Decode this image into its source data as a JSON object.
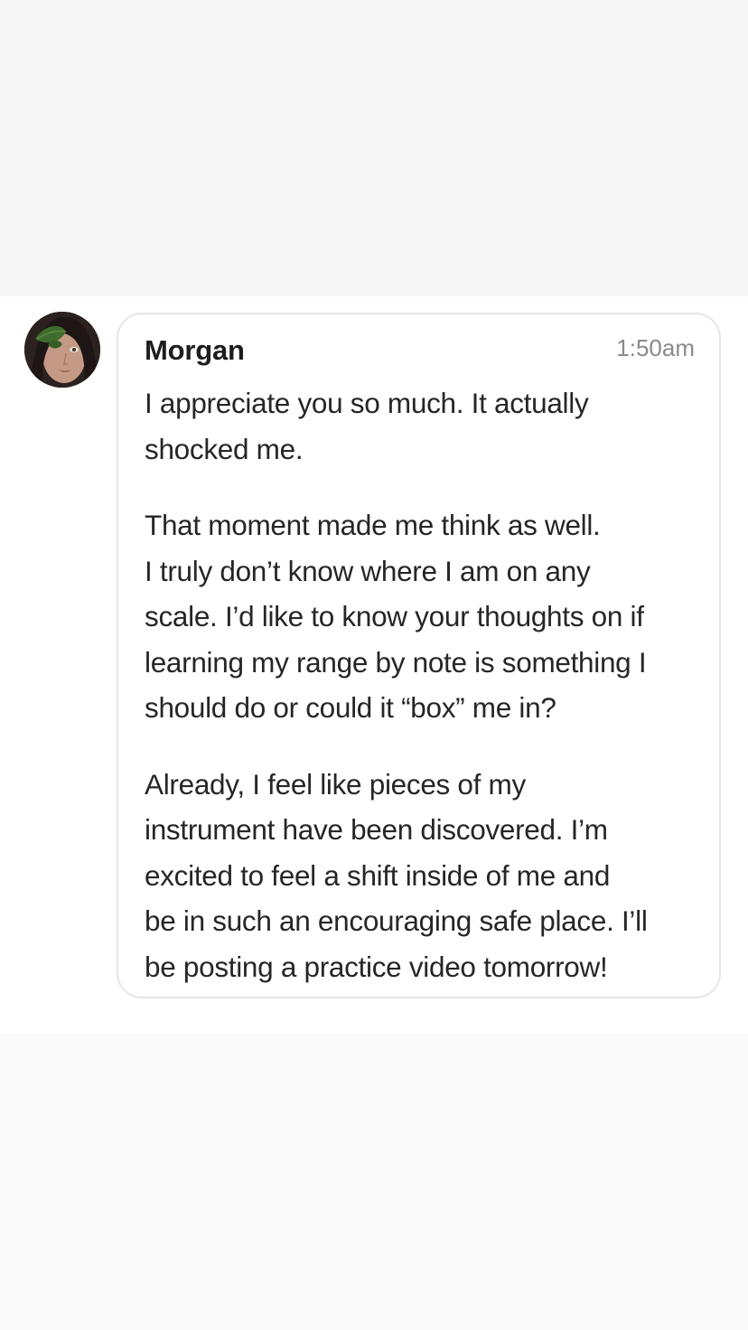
{
  "message": {
    "author": "Morgan",
    "timestamp": "1:50am",
    "paragraphs": [
      {
        "lines": [
          "I appreciate you so much. It actually",
          "shocked me."
        ]
      },
      {
        "lines": [
          "That moment made me think as well.",
          "I truly don’t know where I am on any",
          "scale. I’d like to know your thoughts on if",
          "learning my range by note is something I",
          "should do or could it “box” me in?"
        ]
      },
      {
        "lines": [
          "Already, I feel like pieces of my",
          "instrument have been discovered. I’m",
          "excited to feel a shift inside of me and",
          "be in such an encouraging safe place. I’ll",
          "be posting a practice video tomorrow!"
        ]
      }
    ]
  },
  "colors": {
    "bubble_border": "#e6e6e6",
    "text": "#262626",
    "timestamp": "#8a8a8a"
  },
  "icons": {
    "avatar": "profile-photo"
  }
}
